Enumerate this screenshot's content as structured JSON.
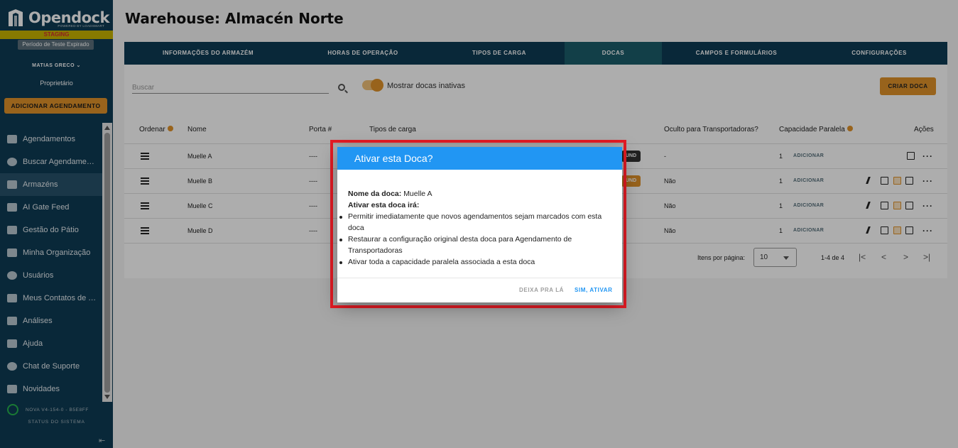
{
  "sidebar": {
    "brand": "Opendock",
    "powered": "POWERED BY LOADSMART",
    "staging": "STAGING",
    "trial": "Período de Teste Expirado",
    "user": "MATIAS GRECO",
    "role": "Proprietário",
    "add_button": "ADICIONAR AGENDAMENTO",
    "items": [
      {
        "label": "Agendamentos",
        "icon": "calendar-icon"
      },
      {
        "label": "Buscar Agendamentos",
        "icon": "search-icon"
      },
      {
        "label": "Armazéns",
        "icon": "warehouse-icon"
      },
      {
        "label": "AI Gate Feed",
        "icon": "camera-icon"
      },
      {
        "label": "Gestão do Pátio",
        "icon": "yard-icon"
      },
      {
        "label": "Minha Organização",
        "icon": "organization-icon"
      },
      {
        "label": "Usuários",
        "icon": "users-icon"
      },
      {
        "label": "Meus Contatos de Transportadoras",
        "icon": "truck-icon"
      },
      {
        "label": "Análises",
        "icon": "analytics-icon"
      },
      {
        "label": "Ajuda",
        "icon": "help-icon"
      },
      {
        "label": "Chat de Suporte",
        "icon": "chat-icon"
      },
      {
        "label": "Novidades",
        "icon": "megaphone-icon"
      }
    ],
    "version": "NOVA V4-154-0 - B5E8FF",
    "system_status": "STATUS DO SISTEMA",
    "collapse": "⇤"
  },
  "header": {
    "title": "Warehouse: Almacén Norte"
  },
  "tabs": [
    {
      "label": "INFORMAÇÕES DO ARMAZÉM"
    },
    {
      "label": "HORAS DE OPERAÇÃO"
    },
    {
      "label": "TIPOS DE CARGA"
    },
    {
      "label": "DOCAS"
    },
    {
      "label": "CAMPOS E FORMULÁRIOS"
    },
    {
      "label": "CONFIGURAÇÕES"
    }
  ],
  "toolbar": {
    "search_placeholder": "Buscar",
    "toggle_label": "Mostrar docas inativas",
    "create_button": "CRIAR DOCA"
  },
  "table": {
    "headers": [
      "Ordenar",
      "Nome",
      "Porta #",
      "Tipos de carga",
      "Oculto para Transportadoras?",
      "Capacidade Paralela",
      "Ações"
    ],
    "rows": [
      {
        "name": "Muelle A",
        "door": "----",
        "tag": "UND",
        "hidden": "-",
        "capacity": "1",
        "add": "ADICIONAR"
      },
      {
        "name": "Muelle B",
        "door": "----",
        "tag": "UND",
        "hidden": "Não",
        "capacity": "1",
        "add": "ADICIONAR"
      },
      {
        "name": "Muelle C",
        "door": "----",
        "tag": "",
        "hidden": "Não",
        "capacity": "1",
        "add": "ADICIONAR"
      },
      {
        "name": "Muelle D",
        "door": "----",
        "tag": "",
        "hidden": "Não",
        "capacity": "1",
        "add": "ADICIONAR"
      }
    ]
  },
  "pagination": {
    "per_page_label": "Itens por página:",
    "per_page_value": "10",
    "range": "1-4 de 4",
    "first": "|<",
    "prev": "<",
    "next": ">",
    "last": ">|"
  },
  "dialog": {
    "title": "Ativar esta Doca?",
    "name_label": "Nome da doca:",
    "name_value": "Muelle A",
    "effects_label": "Ativar esta doca irá:",
    "effects": [
      "Permitir imediatamente que novos agendamentos sejam marcados com esta doca",
      "Restaurar a configuração original desta doca para Agendamento de Transportadoras",
      "Ativar toda a capacidade paralela associada a esta doca"
    ],
    "cancel": "DEIXA PRA LÁ",
    "confirm": "SIM, ATIVAR"
  },
  "colors": {
    "sidebar": "#0e3b54",
    "accent": "#e0922a",
    "dialog_header": "#2196f3",
    "highlight": "#e51b24"
  }
}
